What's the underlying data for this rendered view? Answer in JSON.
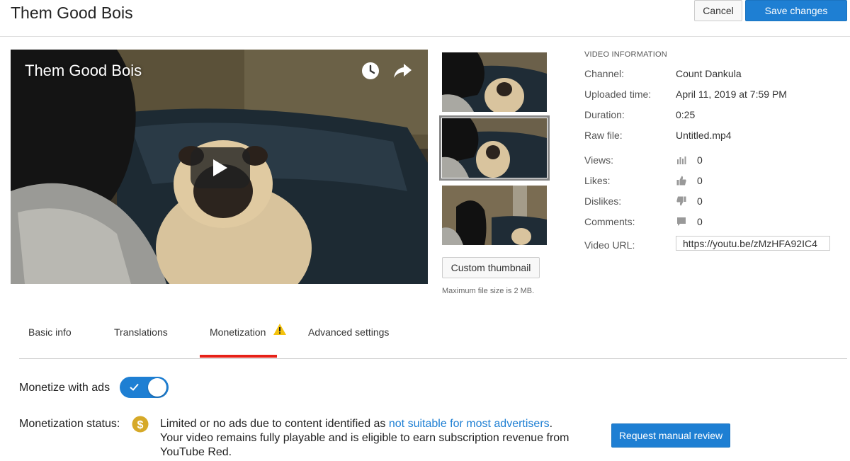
{
  "header": {
    "title": "Them Good Bois",
    "cancel_label": "Cancel",
    "save_label": "Save changes"
  },
  "player": {
    "title": "Them Good Bois",
    "icons": [
      "clock-icon",
      "share-icon",
      "play-icon"
    ]
  },
  "thumbnails": {
    "selected_index": 1,
    "custom_button": "Custom thumbnail",
    "max_size_note": "Maximum file size is 2 MB."
  },
  "video_info": {
    "heading": "VIDEO INFORMATION",
    "channel_label": "Channel:",
    "channel_value": "Count Dankula",
    "uploaded_label": "Uploaded time:",
    "uploaded_value": "April 11, 2019 at 7:59 PM",
    "duration_label": "Duration:",
    "duration_value": "0:25",
    "raw_file_label": "Raw file:",
    "raw_file_value": "Untitled.mp4",
    "views_label": "Views:",
    "views_value": "0",
    "likes_label": "Likes:",
    "likes_value": "0",
    "dislikes_label": "Dislikes:",
    "dislikes_value": "0",
    "comments_label": "Comments:",
    "comments_value": "0",
    "url_label": "Video URL:",
    "url_value": "https://youtu.be/zMzHFA92IC4"
  },
  "tabs": {
    "basic_info": "Basic info",
    "translations": "Translations",
    "monetization": "Monetization",
    "advanced": "Advanced settings",
    "active": "Monetization"
  },
  "monetization": {
    "toggle_label": "Monetize with ads",
    "toggle_on": true,
    "status_label": "Monetization status:",
    "status_text_1": "Limited or no ads due to content identified as ",
    "status_link": "not suitable for most advertisers",
    "status_text_2": ".",
    "status_text_3": "Your video remains fully playable and is eligible to earn subscription revenue from YouTube Red.",
    "review_button": "Request manual review"
  },
  "colors": {
    "accent_blue": "#1e7fd3",
    "tab_active_red": "#e62117",
    "warning_yellow": "#f4c20d",
    "dollar_gold": "#d6a928"
  }
}
